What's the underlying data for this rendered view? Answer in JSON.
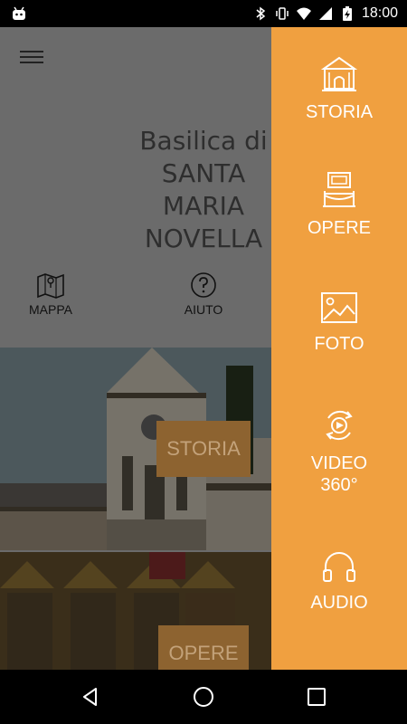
{
  "status_bar": {
    "time": "18:00",
    "icons": [
      "android-icon",
      "bluetooth-icon",
      "vibrate-icon",
      "wifi-icon",
      "signal-icon",
      "battery-charging-icon"
    ]
  },
  "header": {
    "menu_icon": "hamburger-menu-icon",
    "title_line1": "Basilica di",
    "title_line2": "SANTA",
    "title_line3": "MARIA",
    "title_line4": "NOVELLA"
  },
  "shortcuts": {
    "mappa_label": "MAPPA",
    "aiuto_label": "AIUTO"
  },
  "tiles": {
    "storia_label": "STORIA",
    "opere_label": "OPERE"
  },
  "drawer": {
    "color": "#f0a040",
    "items": [
      {
        "label": "STORIA",
        "icon": "church-icon"
      },
      {
        "label": "OPERE",
        "icon": "artwork-icon"
      },
      {
        "label": "FOTO",
        "icon": "photo-icon"
      },
      {
        "label_line1": "VIDEO",
        "label_line2": "360°",
        "icon": "video-360-icon"
      },
      {
        "label": "AUDIO",
        "icon": "headphones-icon"
      }
    ]
  },
  "nav_bar": {
    "icons": [
      "back-icon",
      "home-icon",
      "recent-apps-icon"
    ]
  }
}
